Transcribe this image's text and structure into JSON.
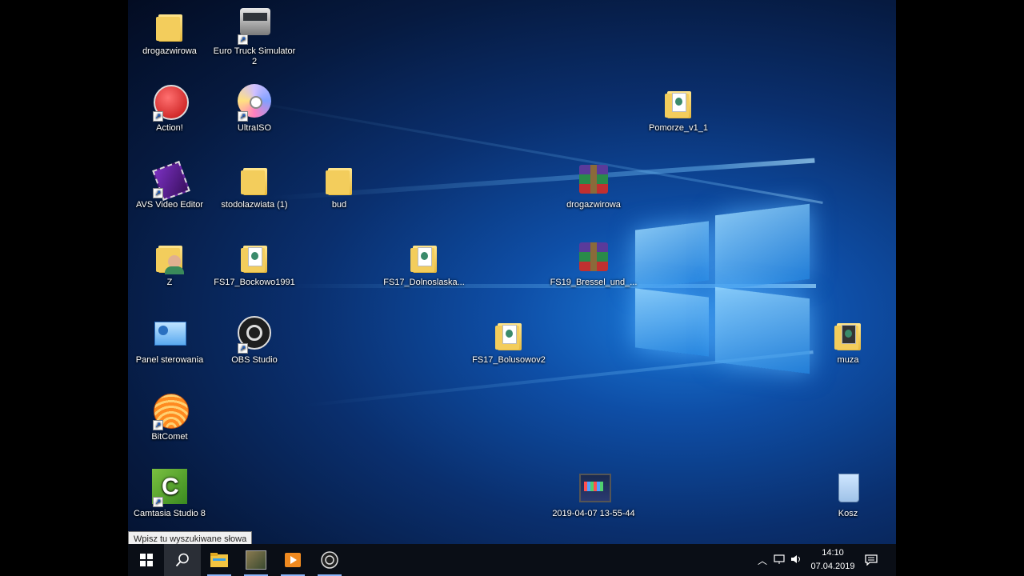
{
  "desktop": {
    "icons": [
      {
        "label": "drogazwirowa",
        "icon": "folder-icon"
      },
      {
        "label": "Euro Truck Simulator 2",
        "icon": "truck-icon"
      },
      {
        "label": "Action!",
        "icon": "action-recorder-icon"
      },
      {
        "label": "UltraISO",
        "icon": "disc-icon"
      },
      {
        "label": "Pomorze_v1_1",
        "icon": "folder-icon"
      },
      {
        "label": "AVS Video Editor",
        "icon": "film-icon"
      },
      {
        "label": "stodolazwiata (1)",
        "icon": "folder-icon"
      },
      {
        "label": "bud",
        "icon": "folder-icon"
      },
      {
        "label": "drogazwirowa",
        "icon": "winrar-icon"
      },
      {
        "label": "Z",
        "icon": "user-folder-icon"
      },
      {
        "label": "FS17_Bockowo1991",
        "icon": "folder-icon"
      },
      {
        "label": "FS17_Dolnoslaska...",
        "icon": "folder-icon"
      },
      {
        "label": "FS19_Bressel_und_...",
        "icon": "winrar-icon"
      },
      {
        "label": "Panel sterowania",
        "icon": "control-panel-icon"
      },
      {
        "label": "OBS Studio",
        "icon": "obs-icon"
      },
      {
        "label": "FS17_Bolusowov2",
        "icon": "folder-icon"
      },
      {
        "label": "muza",
        "icon": "folder-icon"
      },
      {
        "label": "BitComet",
        "icon": "bitcomet-icon"
      },
      {
        "label": "Camtasia Studio 8",
        "icon": "camtasia-icon"
      },
      {
        "label": "2019-04-07 13-55-44",
        "icon": "video-file-icon"
      },
      {
        "label": "Kosz",
        "icon": "recycle-bin-icon"
      }
    ]
  },
  "taskbar": {
    "search_tooltip": "Wpisz tu wyszukiwane słowa",
    "buttons": [
      "start-icon",
      "search-icon",
      "file-explorer-icon",
      "game-icon",
      "media-player-icon",
      "obs-icon"
    ],
    "tray_icons": [
      "chevron-up-icon",
      "network-icon",
      "volume-icon"
    ],
    "time": "14:10",
    "date": "07.04.2019",
    "notification_icon": "notification-icon"
  },
  "colors": {
    "wallpaper_accent": "#1a78d8",
    "taskbar": "#0a0e16"
  }
}
